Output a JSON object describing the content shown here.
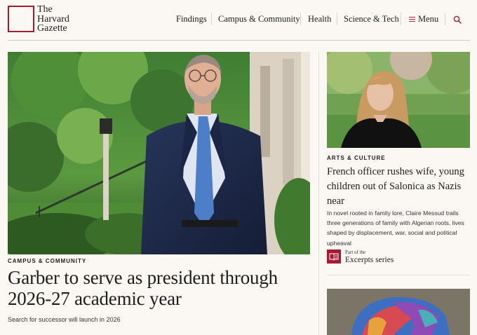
{
  "site": {
    "logo_lines": [
      "The",
      "Harvard",
      "Gazette"
    ]
  },
  "nav": {
    "items": [
      "Findings",
      "Campus & Community",
      "Health",
      "Science & Tech"
    ],
    "menu_label": "Menu",
    "menu_icon": "hamburger-icon",
    "search_icon": "search-icon"
  },
  "colors": {
    "accent": "#a51c30",
    "background": "#fbf7f2"
  },
  "hero": {
    "kicker": "CAMPUS & COMMUNITY",
    "title": "Garber to serve as president through 2026-27 academic year",
    "subtitle": "Search for successor will launch in 2026"
  },
  "side_story": {
    "kicker": "ARTS & CULTURE",
    "title": "French officer rushes wife, young children out of Salonica as Nazis near",
    "dek": "In novel rooted in family lore, Claire Messud trails three generations of family with Algerian roots, lives shaped by displacement, war, social and political upheaval",
    "series_prefix": "Part of the",
    "series_name": "Excerpts series",
    "series_icon": "book-icon"
  }
}
